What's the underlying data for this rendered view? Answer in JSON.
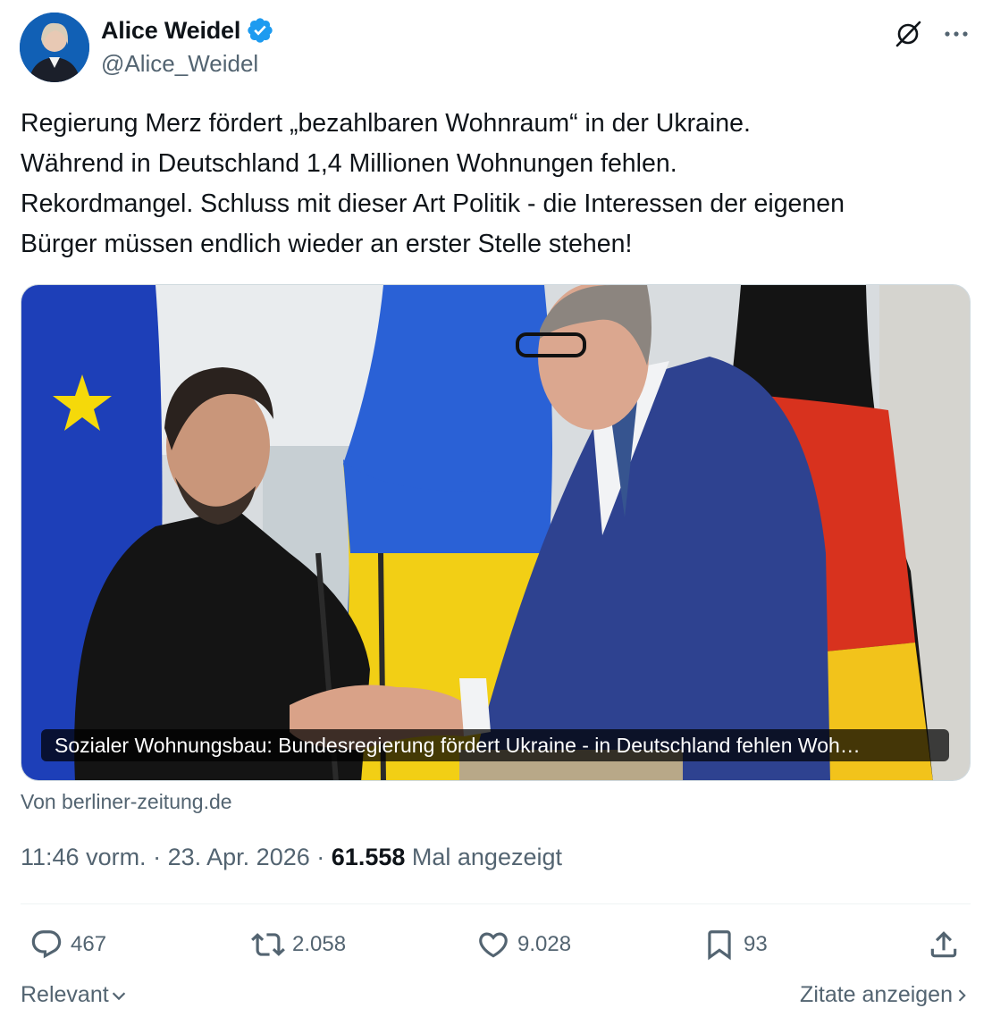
{
  "author": {
    "display_name": "Alice Weidel",
    "handle": "@Alice_Weidel",
    "verified": true,
    "verified_color": "#1d9bf0"
  },
  "tweet": {
    "lines": [
      "Regierung Merz fördert „bezahlbaren Wohnraum“ in der Ukraine.",
      "Während in Deutschland 1,4 Millionen Wohnungen fehlen.",
      "Rekordmangel. Schluss mit dieser Art Politik - die Interessen der eigenen",
      "Bürger müssen endlich wieder an erster Stelle stehen!"
    ]
  },
  "card": {
    "caption": "Sozialer Wohnungsbau: Bundesregierung fördert Ukraine - in Deutschland fehlen Woh…",
    "source": "Von berliner-zeitung.de"
  },
  "meta": {
    "time": "11:46 vorm.",
    "separator": "·",
    "date": "23. Apr. 2026",
    "views": "61.558",
    "views_label": "Mal angezeigt"
  },
  "actions": {
    "replies": "467",
    "reposts": "2.058",
    "likes": "9.028",
    "bookmarks": "93"
  },
  "footer": {
    "sort_label": "Relevant",
    "quotes_label": "Zitate anzeigen"
  },
  "icons": {
    "verified": "verified-badge-icon",
    "grok": "grok-icon",
    "more": "more-icon",
    "reply": "reply-icon",
    "repost": "repost-icon",
    "like": "heart-icon",
    "bookmark": "bookmark-icon",
    "share": "share-icon"
  }
}
